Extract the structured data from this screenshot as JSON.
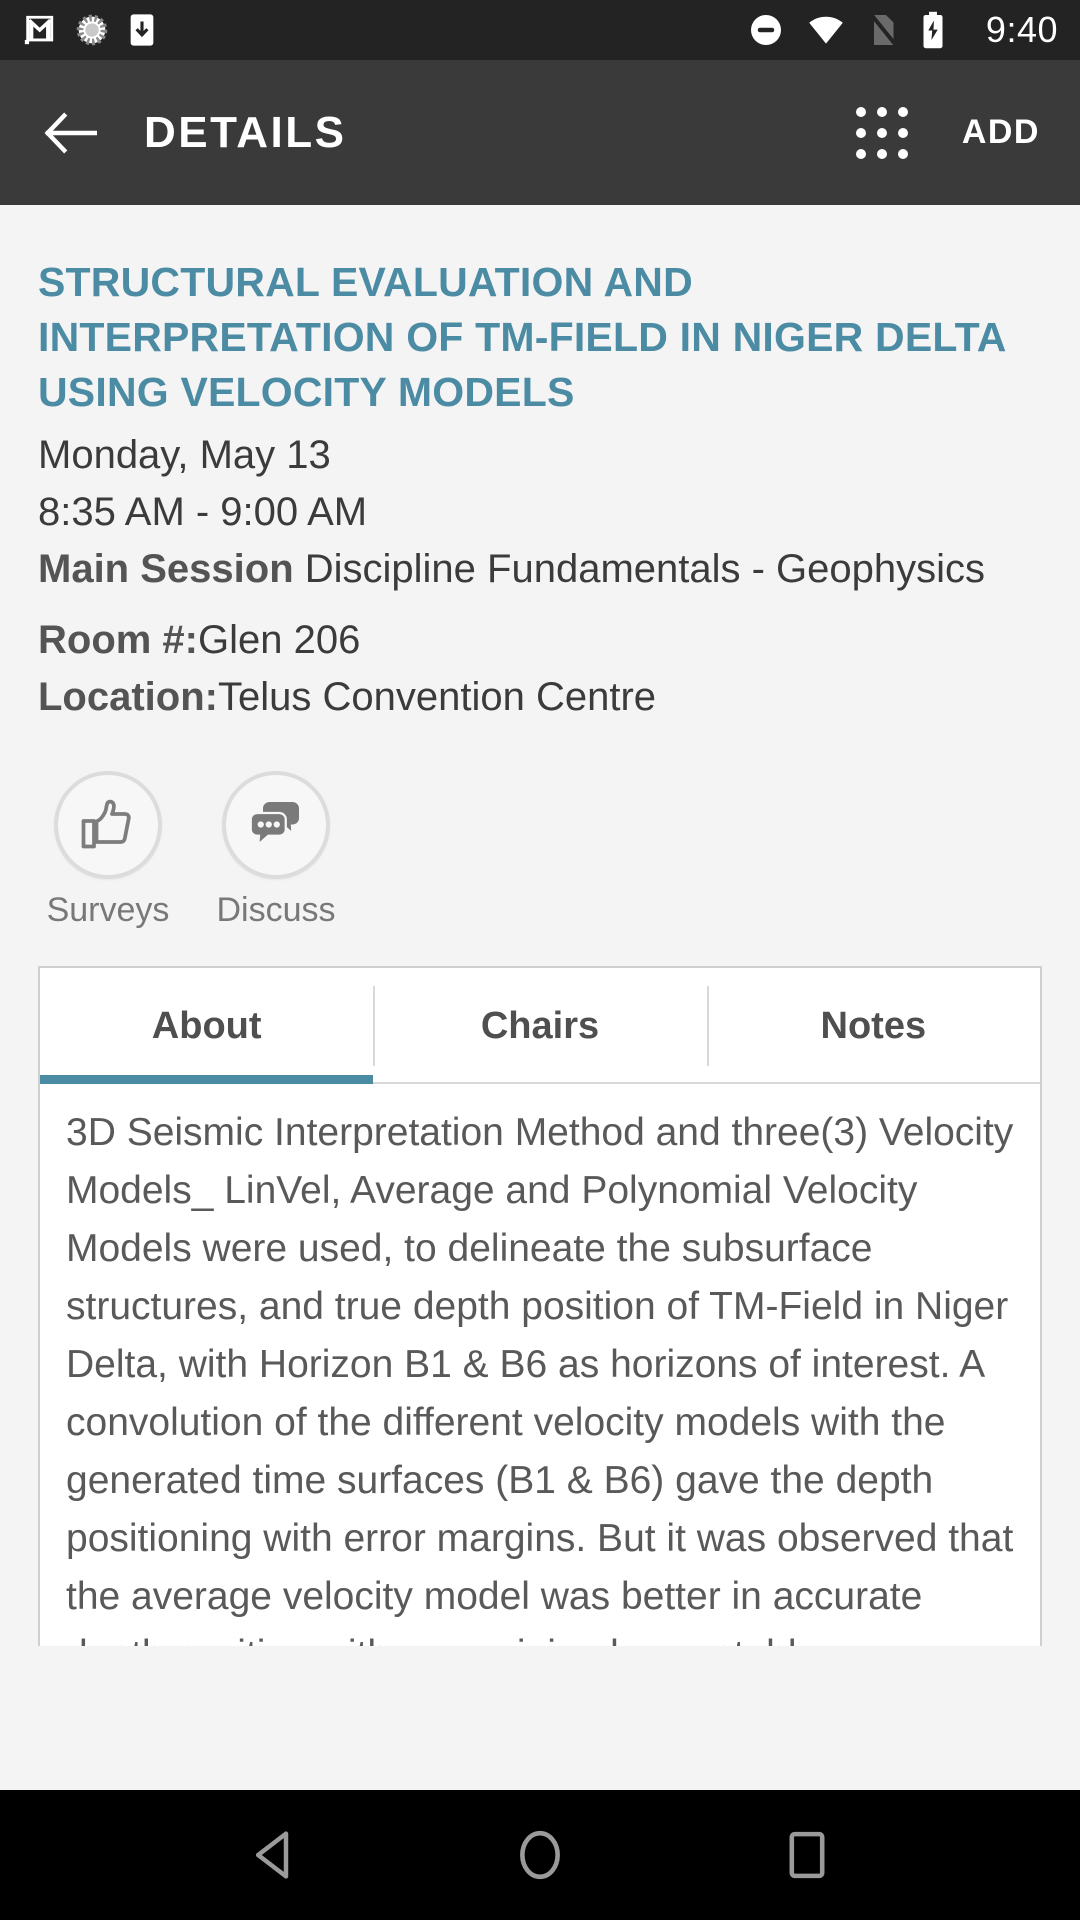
{
  "status_bar": {
    "icons": [
      "gmail-icon",
      "sync-spinner-icon",
      "app-download-icon",
      "do-not-disturb-icon",
      "wifi-icon",
      "no-sim-icon",
      "battery-charging-icon"
    ],
    "clock": "9:40"
  },
  "app_bar": {
    "back_icon": "arrow-back-icon",
    "title": "DETAILS",
    "grid_icon": "apps-grid-icon",
    "add_label": "ADD"
  },
  "session": {
    "title": "STRUCTURAL EVALUATION AND INTERPRETATION OF TM-FIELD IN NIGER DELTA USING VELOCITY MODELS",
    "date": "Monday, May 13",
    "time": "8:35 AM - 9:00 AM",
    "session_type_label": "Main Session",
    "session_type_value": " Discipline Fundamentals - Geophysics",
    "room_label": "Room #:",
    "room_value": "Glen 206",
    "location_label": "Location:",
    "location_value": "Telus Convention Centre"
  },
  "actions": [
    {
      "label": "Surveys",
      "icon": "thumbs-up-icon"
    },
    {
      "label": "Discuss",
      "icon": "chat-bubbles-icon"
    }
  ],
  "tabs": [
    {
      "label": "About",
      "active": true
    },
    {
      "label": "Chairs",
      "active": false
    },
    {
      "label": "Notes",
      "active": false
    }
  ],
  "about": {
    "body": "3D Seismic Interpretation Method and three(3) Velocity Models_ LinVel, Average and Polynomial Velocity Models were used, to delineate the subsurface structures, and true depth position of TM-Field in Niger Delta, with Horizon B1 & B6 as horizons of interest. A convolution of the different velocity models with the generated time surfaces (B1 & B6) gave the depth positioning with error margins. But it was observed that the average velocity model was better in accurate depth position with very minimal acceptable"
  },
  "nav_bar": {
    "back_icon": "nav-back-triangle-icon",
    "home_icon": "nav-home-circle-icon",
    "recents_icon": "nav-recents-square-icon"
  },
  "colors": {
    "accent": "#4b8ba3",
    "status_bar_bg": "#232323",
    "app_bar_bg": "#3a3a3a",
    "page_bg": "#f4f4f4",
    "nav_bar_bg": "#000000"
  }
}
